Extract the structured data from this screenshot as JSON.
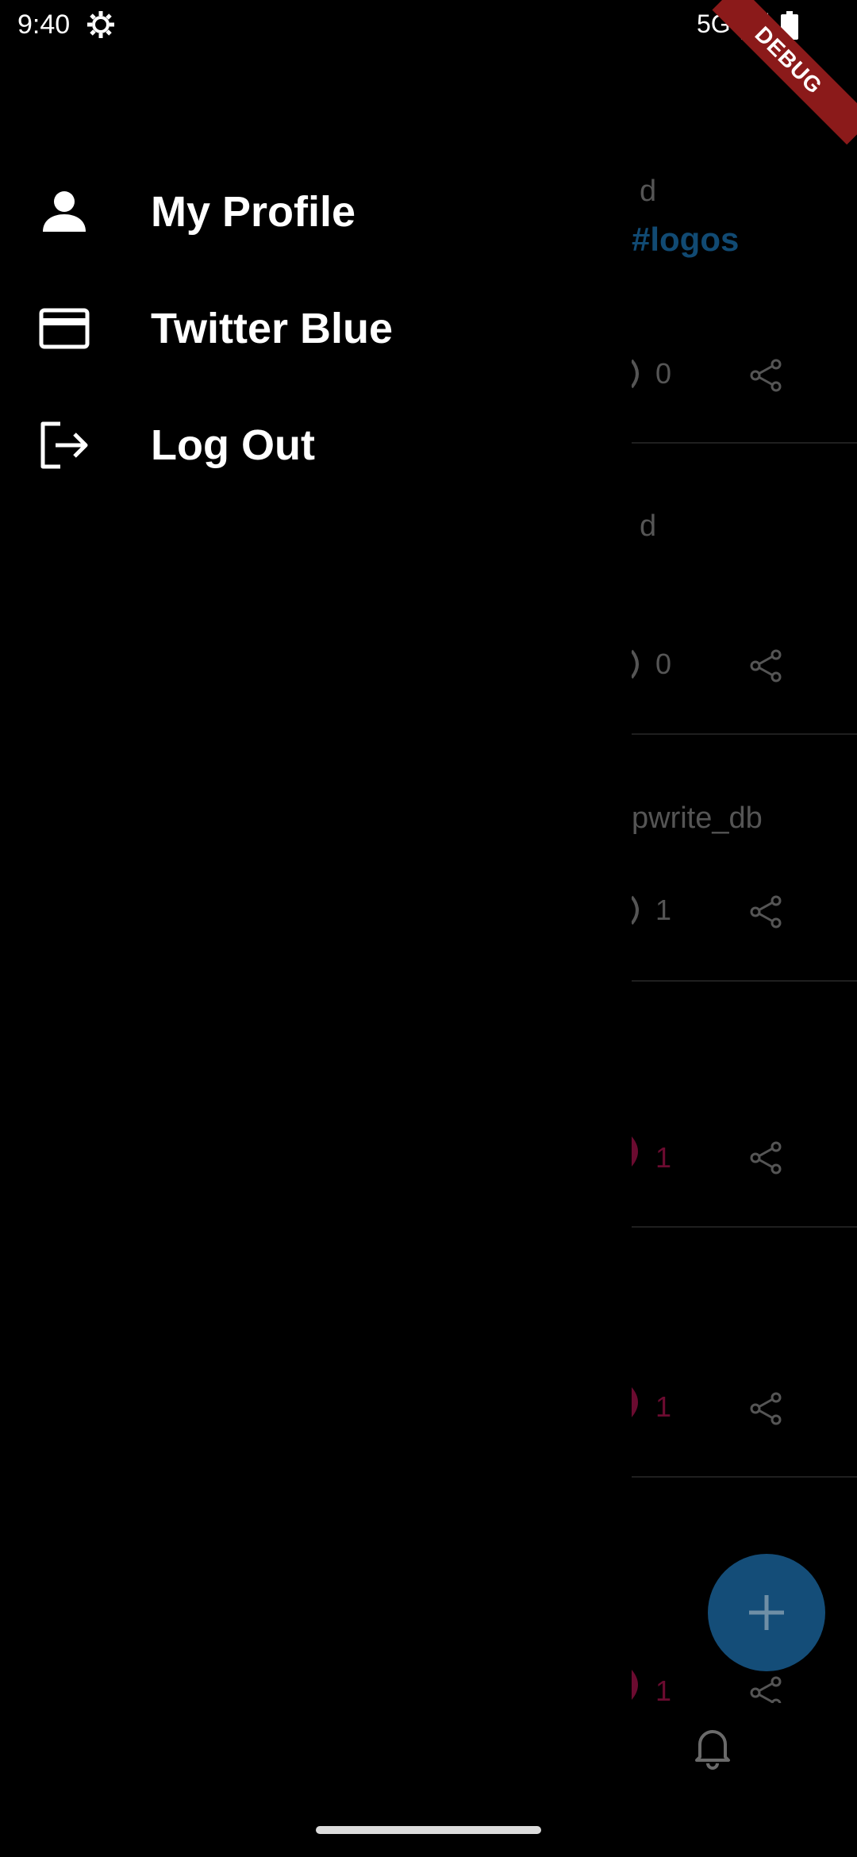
{
  "status_bar": {
    "time": "9:40",
    "network": "5G"
  },
  "debug_banner": "DEBUG",
  "drawer": {
    "items": [
      {
        "label": "My Profile",
        "icon": "person-icon"
      },
      {
        "label": "Twitter Blue",
        "icon": "credit-card-icon"
      },
      {
        "label": "Log Out",
        "icon": "logout-icon"
      }
    ]
  },
  "feed": {
    "fragments": [
      {
        "text_top": "d",
        "hashtag": "#logos",
        "comment_count": "0"
      },
      {
        "text_top": "d",
        "comment_count": "0"
      },
      {
        "text_top": "pwrite_db",
        "comment_count": "1"
      },
      {
        "like_count": "1"
      },
      {
        "like_count": "1"
      },
      {
        "like_count": "1"
      }
    ]
  },
  "fab_icon": "plus-icon",
  "bottom_nav_icon": "bell-icon",
  "colors": {
    "background": "#000000",
    "fab": "#144d78",
    "hashtag": "#114a73",
    "like": "#6b0b30",
    "debug": "#8b1a1a"
  }
}
